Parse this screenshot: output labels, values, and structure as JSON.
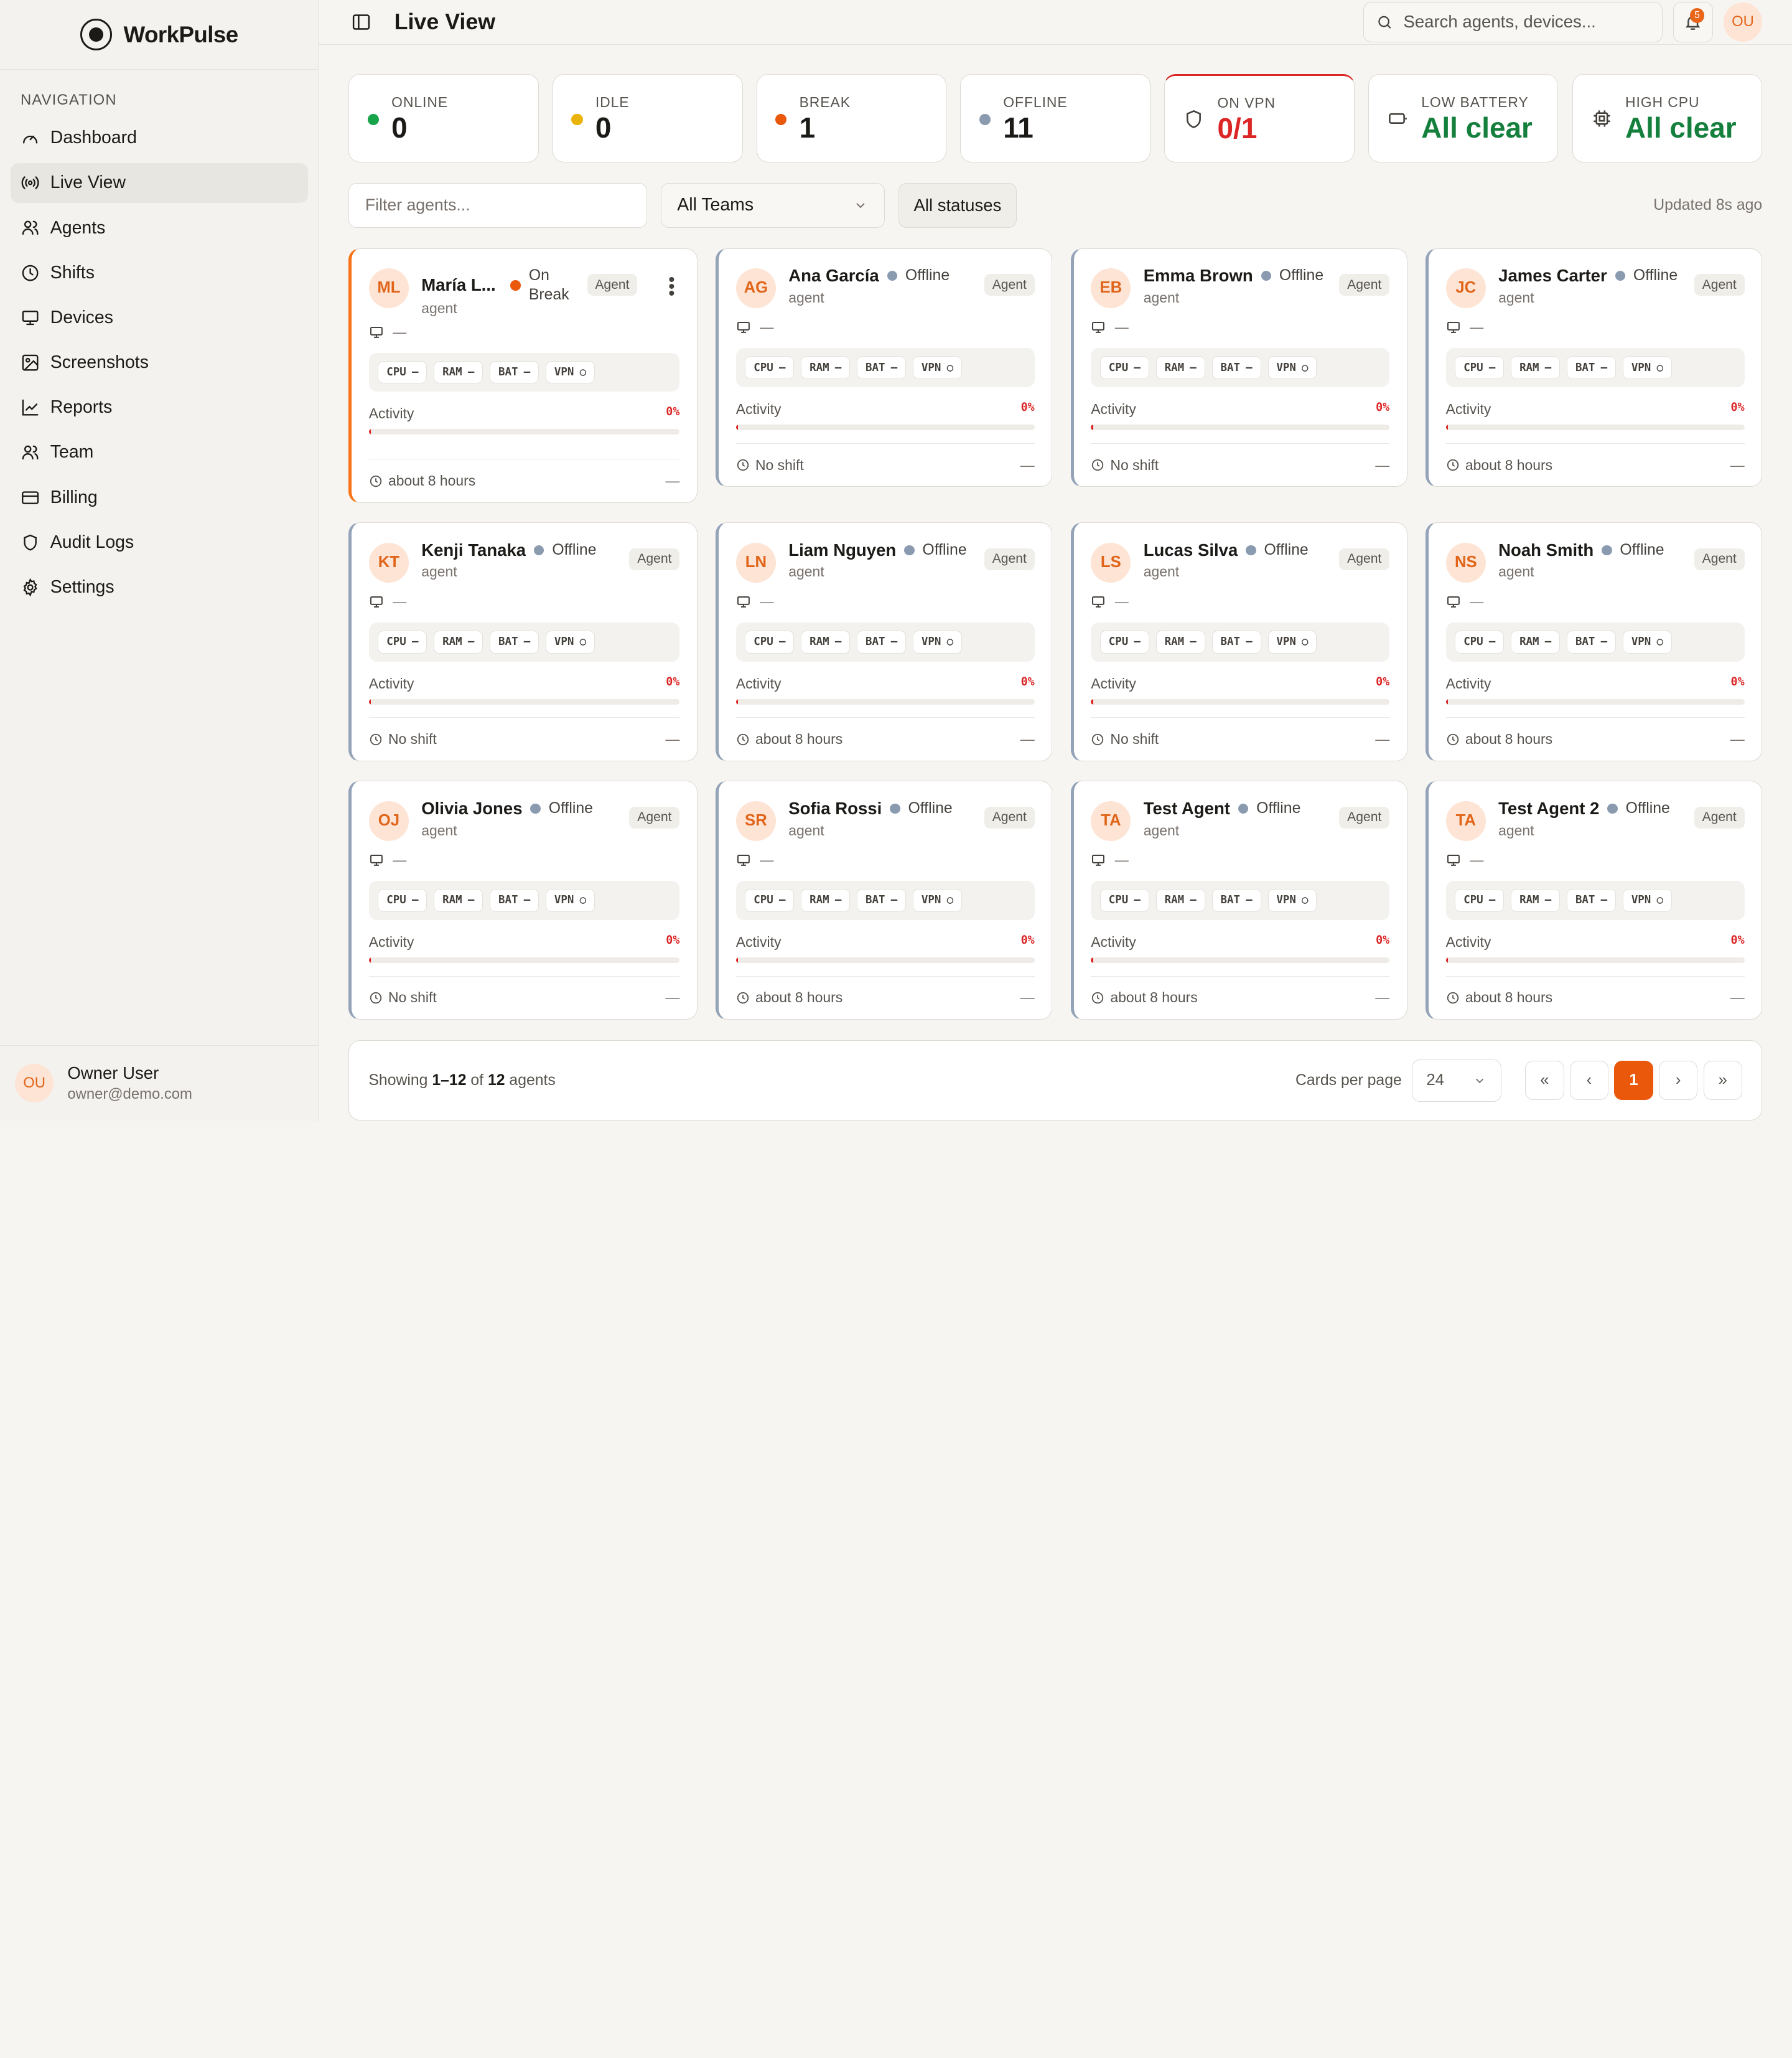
{
  "brand": {
    "name": "WorkPulse"
  },
  "sidebar": {
    "heading": "NAVIGATION",
    "items": [
      {
        "label": "Dashboard",
        "icon": "dashboard-icon",
        "active": false
      },
      {
        "label": "Live View",
        "icon": "live-view-icon",
        "active": true
      },
      {
        "label": "Agents",
        "icon": "agents-icon",
        "active": false
      },
      {
        "label": "Shifts",
        "icon": "clock-icon",
        "active": false
      },
      {
        "label": "Devices",
        "icon": "monitor-icon",
        "active": false
      },
      {
        "label": "Screenshots",
        "icon": "image-icon",
        "active": false
      },
      {
        "label": "Reports",
        "icon": "chart-icon",
        "active": false
      },
      {
        "label": "Team",
        "icon": "team-icon",
        "active": false
      },
      {
        "label": "Billing",
        "icon": "credit-card-icon",
        "active": false
      },
      {
        "label": "Audit Logs",
        "icon": "shield-icon",
        "active": false
      },
      {
        "label": "Settings",
        "icon": "gear-icon",
        "active": false
      }
    ],
    "user": {
      "initials": "OU",
      "name": "Owner User",
      "email": "owner@demo.com"
    }
  },
  "header": {
    "title": "Live View",
    "search_placeholder": "Search agents, devices...",
    "notification_count": "5",
    "user_initials": "OU"
  },
  "stats": {
    "online": {
      "label": "ONLINE",
      "value": "0"
    },
    "idle": {
      "label": "IDLE",
      "value": "0"
    },
    "break": {
      "label": "BREAK",
      "value": "1"
    },
    "offline": {
      "label": "OFFLINE",
      "value": "11"
    },
    "vpn": {
      "label": "ON VPN",
      "value": "0/1"
    },
    "battery": {
      "label": "LOW BATTERY",
      "value": "All clear"
    },
    "cpu": {
      "label": "HIGH CPU",
      "value": "All clear"
    }
  },
  "filters": {
    "placeholder": "Filter agents...",
    "teams": "All Teams",
    "statuses": "All statuses",
    "updated": "Updated 8s ago"
  },
  "metric_labels": {
    "cpu": "CPU",
    "ram": "RAM",
    "bat": "BAT",
    "vpn": "VPN",
    "empty": "—",
    "vpn_icon": "○"
  },
  "activity_label": "Activity",
  "agents": [
    {
      "initials": "ML",
      "name": "María L...",
      "status": "On Break",
      "role": "agent",
      "badge": "Agent",
      "device": "—",
      "activity": "0%",
      "activity_fraction": 0,
      "shift": "about 8 hours",
      "foot_dash": "—"
    },
    {
      "initials": "AG",
      "name": "Ana García",
      "status": "Offline",
      "role": "agent",
      "badge": "Agent",
      "device": "—",
      "activity": "0%",
      "activity_fraction": 0,
      "shift": "No shift",
      "foot_dash": "—"
    },
    {
      "initials": "EB",
      "name": "Emma Brown",
      "status": "Offline",
      "role": "agent",
      "badge": "Agent",
      "device": "—",
      "activity": "0%",
      "activity_fraction": 0,
      "shift": "No shift",
      "foot_dash": "—"
    },
    {
      "initials": "JC",
      "name": "James Carter",
      "status": "Offline",
      "role": "agent",
      "badge": "Agent",
      "device": "—",
      "activity": "0%",
      "activity_fraction": 0,
      "shift": "about 8 hours",
      "foot_dash": "—"
    },
    {
      "initials": "KT",
      "name": "Kenji Tanaka",
      "status": "Offline",
      "role": "agent",
      "badge": "Agent",
      "device": "—",
      "activity": "0%",
      "activity_fraction": 0,
      "shift": "No shift",
      "foot_dash": "—"
    },
    {
      "initials": "LN",
      "name": "Liam Nguyen",
      "status": "Offline",
      "role": "agent",
      "badge": "Agent",
      "device": "—",
      "activity": "0%",
      "activity_fraction": 0,
      "shift": "about 8 hours",
      "foot_dash": "—"
    },
    {
      "initials": "LS",
      "name": "Lucas Silva",
      "status": "Offline",
      "role": "agent",
      "badge": "Agent",
      "device": "—",
      "activity": "0%",
      "activity_fraction": 0,
      "shift": "No shift",
      "foot_dash": "—"
    },
    {
      "initials": "NS",
      "name": "Noah Smith",
      "status": "Offline",
      "role": "agent",
      "badge": "Agent",
      "device": "—",
      "activity": "0%",
      "activity_fraction": 0,
      "shift": "about 8 hours",
      "foot_dash": "—"
    },
    {
      "initials": "OJ",
      "name": "Olivia Jones",
      "status": "Offline",
      "role": "agent",
      "badge": "Agent",
      "device": "—",
      "activity": "0%",
      "activity_fraction": 0,
      "shift": "No shift",
      "foot_dash": "—"
    },
    {
      "initials": "SR",
      "name": "Sofia Rossi",
      "status": "Offline",
      "role": "agent",
      "badge": "Agent",
      "device": "—",
      "activity": "0%",
      "activity_fraction": 0,
      "shift": "about 8 hours",
      "foot_dash": "—"
    },
    {
      "initials": "TA",
      "name": "Test Agent",
      "status": "Offline",
      "role": "agent",
      "badge": "Agent",
      "device": "—",
      "activity": "0%",
      "activity_fraction": 0,
      "shift": "about 8 hours",
      "foot_dash": "—"
    },
    {
      "initials": "TA",
      "name": "Test Agent 2",
      "status": "Offline",
      "role": "agent",
      "badge": "Agent",
      "device": "—",
      "activity": "0%",
      "activity_fraction": 0,
      "shift": "about 8 hours",
      "foot_dash": "—"
    }
  ],
  "pagination": {
    "showing_prefix": "Showing",
    "range": "1–12",
    "of": "of",
    "total": "12",
    "suffix": "agents",
    "per_page_label": "Cards per page",
    "per_page": "24",
    "first": "«",
    "prev": "‹",
    "current": "1",
    "next": "›",
    "last": "»"
  },
  "colors": {
    "accent": "#ea580c",
    "online": "#16a34a",
    "idle": "#eab308",
    "break": "#ea580c",
    "offline": "#8a9bb0",
    "alert": "#dc2626",
    "clear": "#15803d"
  }
}
